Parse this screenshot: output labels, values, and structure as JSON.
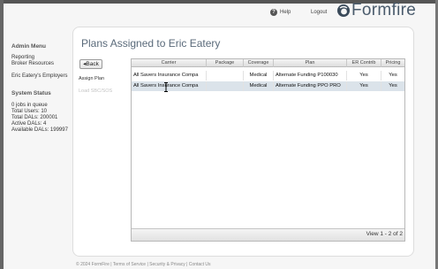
{
  "header": {
    "help_label": "Help",
    "logout_label": "Logout",
    "logo_text": "Formfire"
  },
  "sidebar": {
    "admin_menu_title": "Admin Menu",
    "links": [
      "Reporting",
      "Broker Resources",
      "Eric Eatery's Employers"
    ],
    "system_status_title": "System Status",
    "status_lines": [
      "0 jobs in queue",
      "Total Users: 10",
      "Total DALs: 200001",
      "Active DALs: 4",
      "Available DALs: 199997"
    ]
  },
  "main": {
    "title": "Plans Assigned to Eric Eatery",
    "back_label": "Back",
    "nav_items": [
      "Assign Plan",
      "Load SBC/SOS"
    ]
  },
  "grid": {
    "columns": [
      "Carrier",
      "Package",
      "Coverage",
      "Plan",
      "ER Contrib",
      "Pricing"
    ],
    "rows": [
      [
        "All Savers Insurance Compa",
        "",
        "Medical",
        "Alternate Funding P100030",
        "Yes",
        "Yes"
      ],
      [
        "All Savers Insurance Compa",
        "",
        "Medical",
        "Alternate Funding PPO PRO",
        "Yes",
        "Yes"
      ]
    ],
    "selected_row": 1,
    "pager_text": "View 1 - 2 of 2"
  },
  "footer": {
    "text": "© 2024 FormFire | Terms of Service | Security & Privacy | Contact Us"
  },
  "colors": {
    "title": "#5a6a7a",
    "selected_row": "#dbe3ea",
    "logo": "#4a5b6c"
  }
}
